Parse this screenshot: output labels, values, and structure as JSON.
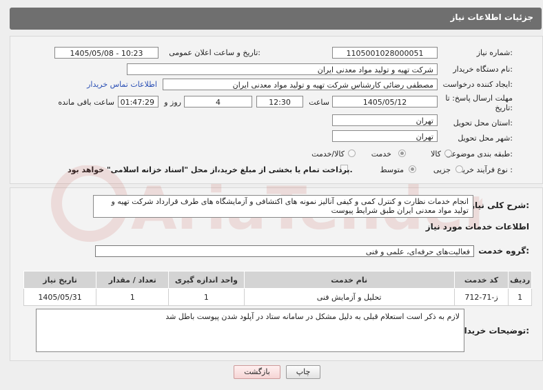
{
  "header": {
    "title": "جزئیات اطلاعات نیاز"
  },
  "form": {
    "need_number_label": "شماره نیاز:",
    "need_number": "1105001028000051",
    "announce_label": "تاریخ و ساعت اعلان عمومی:",
    "announce_value": "1405/05/08 - 10:23",
    "buyer_org_label": "نام دستگاه خریدار:",
    "buyer_org": "شرکت تهیه و تولید مواد معدنی ایران",
    "creator_label": "ایجاد کننده درخواست:",
    "creator": "مصطفی رضائی کارشناس شرکت تهیه و تولید مواد معدنی ایران",
    "contact_link": "اطلاعات تماس خریدار",
    "deadline_label_1": "مهلت ارسال پاسخ: تا",
    "deadline_label_2": "تاریخ:",
    "deadline_date": "1405/05/12",
    "time_label": "ساعت",
    "deadline_time": "12:30",
    "days_value": "4",
    "days_label": "روز و",
    "remaining_time": "01:47:29",
    "remaining_label": "ساعت باقی مانده",
    "province_label": "استان محل تحویل:",
    "province": "تهران",
    "city_label": "شهر محل تحویل:",
    "city": "تهران",
    "category_label": "طبقه بندی موضوعی:",
    "category_options": [
      "کالا",
      "خدمت",
      "کالا/خدمت"
    ],
    "category_selected": "خدمت",
    "process_label": "نوع فرآیند خرید :",
    "process_options": [
      "جزیی",
      "متوسط"
    ],
    "process_selected": "متوسط",
    "payment_note": "پرداخت تمام یا بخشی از مبلغ خرید،از محل \"اسناد خزانه اسلامی\" خواهد بود."
  },
  "details": {
    "description_label": "شرح کلی نیاز:",
    "description": "انجام خدمات نظارت و کنترل کمی و کیفی آنالیز نمونه های اکتشافی و آزمایشگاه های طرف قرارداد شرکت تهیه و تولید مواد معدنی ایران طبق شرایط پیوست",
    "services_heading": "اطلاعات خدمات مورد نیاز",
    "service_group_label": "گروه خدمت:",
    "service_group": "فعالیت‌های حرفه‌ای، علمی و فنی",
    "table": {
      "columns": [
        "ردیف",
        "کد خدمت",
        "نام خدمت",
        "واحد اندازه گیری",
        "تعداد / مقدار",
        "تاریخ نیاز"
      ],
      "rows": [
        [
          "1",
          "ز-71-712",
          "تحلیل و آزمایش فنی",
          "1",
          "1",
          "1405/05/31"
        ]
      ]
    },
    "buyer_notes_label": "توضیحات خریدار:",
    "buyer_notes": "لازم به ذکر است استعلام قبلی به دلیل مشکل در سامانه ستاد در آپلود شدن پیوست باطل شد"
  },
  "buttons": {
    "print": "چاپ",
    "back": "بازگشت"
  },
  "watermark": {
    "text": "AriaTender.net"
  },
  "colors": {
    "header_bg": "#6f6f6f",
    "link": "#2a4fb5",
    "watermark": "#c0392b"
  }
}
